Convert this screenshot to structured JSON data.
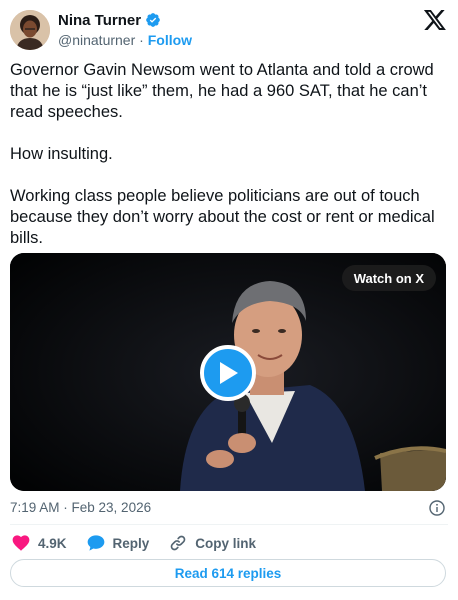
{
  "author": {
    "name": "Nina Turner",
    "handle": "@ninaturner",
    "separator": "·",
    "follow_label": "Follow"
  },
  "tweet": {
    "paragraphs": [
      "Governor Gavin Newsom went to Atlanta and told a crowd that he is “just like” them, he had a 960 SAT, that he can’t read speeches.",
      "How insulting.",
      "Working class people believe politicians are out of touch because they don’t worry about the cost or rent or medical bills."
    ]
  },
  "media": {
    "watch_label": "Watch on X"
  },
  "meta": {
    "timestamp": "7:19 AM · Feb 23, 2026"
  },
  "actions": {
    "like_count": "4.9K",
    "reply_label": "Reply",
    "copy_link_label": "Copy link"
  },
  "read_replies_label": "Read 614 replies",
  "colors": {
    "accent": "#1d9bf0",
    "like": "#f91880",
    "text": "#0f1419",
    "secondary": "#536471"
  },
  "icons": [
    "verified-badge-icon",
    "x-logo-icon",
    "play-icon",
    "info-icon",
    "heart-icon",
    "reply-bubble-icon",
    "link-icon"
  ]
}
